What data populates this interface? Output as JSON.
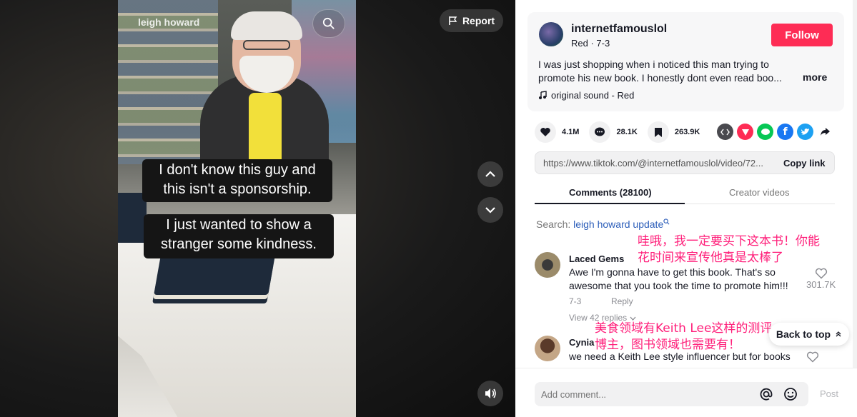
{
  "video": {
    "watermark": "leigh howard",
    "caption_1": "I don't know this guy and this isn't a sponsorship.",
    "caption_2": "I just wanted to show a stranger some kindness.",
    "report_label": "Report"
  },
  "post": {
    "username": "internetfamouslol",
    "subline": "Red · 7-3",
    "follow_label": "Follow",
    "description": "I was just shopping when i noticed this man trying to promote his new book. I honestly dont even read boo...",
    "more_label": "more",
    "sound": "original sound - Red"
  },
  "stats": {
    "likes": "4.1M",
    "comments": "28.1K",
    "saves": "263.9K"
  },
  "link": {
    "url": "https://www.tiktok.com/@internetfamouslol/video/72...",
    "copy_label": "Copy link"
  },
  "tabs": {
    "comments": "Comments (28100)",
    "creator": "Creator videos"
  },
  "search_hint": {
    "prefix": "Search:",
    "keyword": "leigh howard update"
  },
  "comments": [
    {
      "name": "Laced Gems",
      "text": "Awe I'm gonna have to get this book. That's so awesome that you took the time to promote him!!!",
      "date": "7-3",
      "reply_label": "Reply",
      "likes": "301.7K",
      "view_replies": "View 42 replies"
    },
    {
      "name": "Cynia",
      "text": "we need a Keith Lee style influencer but for books"
    }
  ],
  "annotations": {
    "note_1": "哇哦，我一定要买下这本书！你能花时间来宣传他真是太棒了",
    "note_2": "美食领域有Keith Lee这样的测评博主，图书领域也需要有！"
  },
  "back_to_top": "Back to top",
  "composer": {
    "placeholder": "Add comment...",
    "post_label": "Post"
  },
  "colors": {
    "accent": "#fe2c55",
    "annotation": "#ff1f7a",
    "search_keyword": "#2b5db9"
  }
}
